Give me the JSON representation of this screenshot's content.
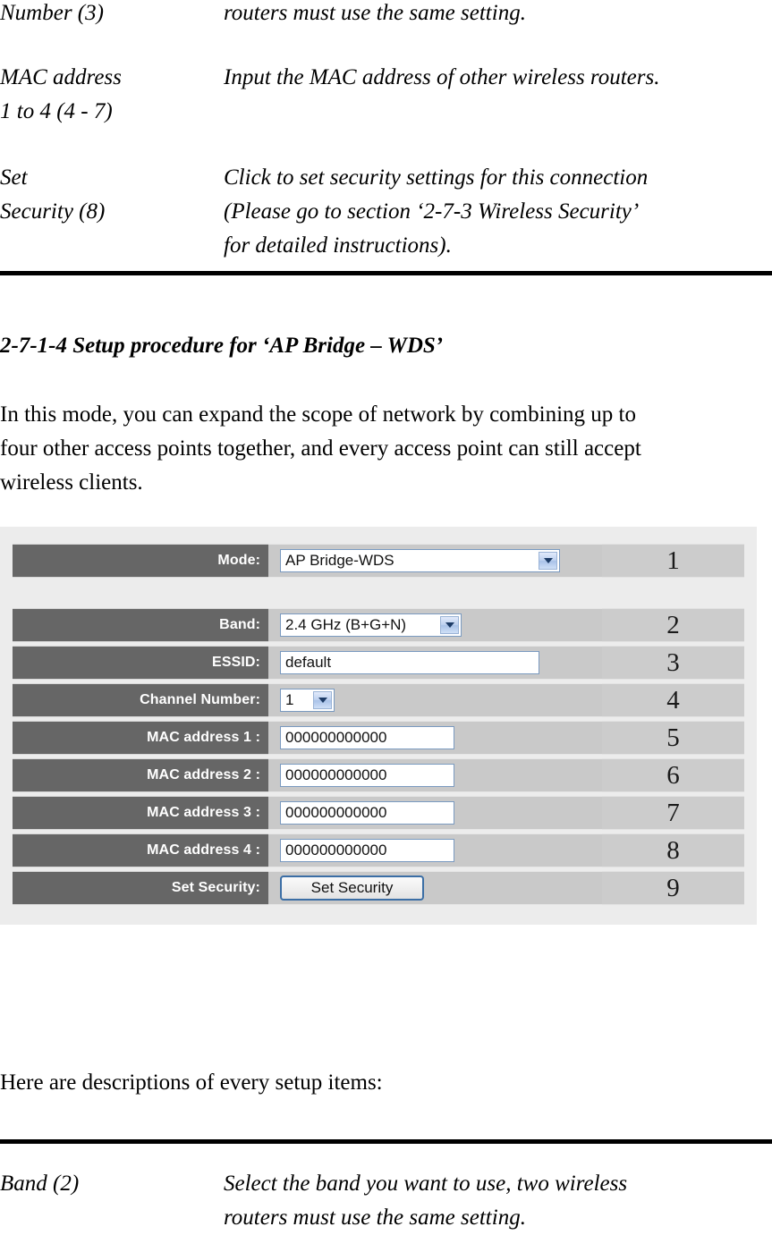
{
  "doc": {
    "top_entries": [
      {
        "term_lines": [
          "Number (3)"
        ],
        "desc_lines": [
          "routers must use the same setting."
        ]
      },
      {
        "term_lines": [
          "MAC address",
          "1 to 4 (4 - 7)"
        ],
        "desc_lines": [
          "Input the MAC address of other wireless routers."
        ]
      },
      {
        "term_lines": [
          "Set",
          "Security (8)"
        ],
        "desc_lines": [
          "Click to set security settings for this connection",
          "(Please go to section ‘2-7-3 Wireless Security’",
          "for detailed instructions)."
        ]
      }
    ],
    "section_heading": "2-7-1-4 Setup procedure for ‘AP Bridge – WDS’",
    "intro_lines": [
      "In this mode, you can expand the scope of network by combining up to",
      "four other access points together, and every access point can still accept",
      "wireless clients."
    ],
    "after_figure_text": "Here are descriptions of every setup items:",
    "bottom_entries": [
      {
        "term_lines": [
          "Band (2)"
        ],
        "desc_lines": [
          "Select the band you want to use, two wireless",
          "routers must use the same setting."
        ]
      }
    ]
  },
  "figure": {
    "panel_bg": "#ececec",
    "label_bg": "#666666",
    "field_bg": "#c9c9c9",
    "number_bg": "#cccccc",
    "rows": [
      {
        "label": "Mode:",
        "control": "select",
        "value": "AP Bridge-WDS",
        "number": "1"
      },
      {
        "label": "Band:",
        "control": "select",
        "value": "2.4 GHz (B+G+N)",
        "number": "2"
      },
      {
        "label": "ESSID:",
        "control": "text",
        "value": "default",
        "number": "3"
      },
      {
        "label": "Channel Number:",
        "control": "select",
        "value": "1",
        "number": "4"
      },
      {
        "label": "MAC address 1 :",
        "control": "text",
        "value": "000000000000",
        "number": "5"
      },
      {
        "label": "MAC address 2 :",
        "control": "text",
        "value": "000000000000",
        "number": "6"
      },
      {
        "label": "MAC address 3 :",
        "control": "text",
        "value": "000000000000",
        "number": "7"
      },
      {
        "label": "MAC address 4 :",
        "control": "text",
        "value": "000000000000",
        "number": "8"
      },
      {
        "label": "Set Security:",
        "control": "button",
        "value": "Set Security",
        "number": "9"
      }
    ]
  }
}
